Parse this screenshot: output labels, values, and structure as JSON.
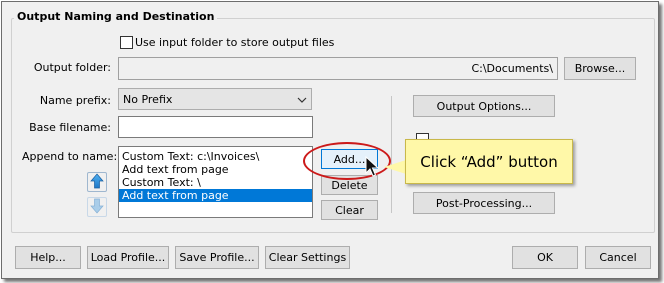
{
  "group": {
    "title": "Output Naming and Destination"
  },
  "use_input_folder": {
    "label": "Use input folder to store output files",
    "checked": false
  },
  "output_folder": {
    "label": "Output folder:",
    "value": "C:\\Documents\\",
    "browse": "Browse..."
  },
  "name_prefix": {
    "label": "Name prefix:",
    "value": "No Prefix"
  },
  "base_filename": {
    "label": "Base filename:",
    "value": ""
  },
  "append": {
    "label": "Append to name:",
    "items": [
      "Custom Text: c:\\Invoices\\",
      "Add text from page",
      "Custom Text: \\",
      "Add text from page"
    ],
    "selected_index": 3,
    "add": "Add...",
    "delete": "Delete",
    "clear": "Clear"
  },
  "right_buttons": {
    "output_options": "Output Options...",
    "post_processing": "Post-Processing..."
  },
  "callout": {
    "text": "Click “Add” button"
  },
  "footer": {
    "help": "Help...",
    "load_profile": "Load Profile...",
    "save_profile": "Save Profile...",
    "clear_settings": "Clear Settings",
    "ok": "OK",
    "cancel": "Cancel"
  },
  "colors": {
    "selection": "#0078d7",
    "annotation_oval": "#cc1a1a",
    "callout_fill": "#fff8a8"
  },
  "icons": [
    "move-up-arrow-icon",
    "move-down-arrow-icon",
    "chevron-down-icon",
    "mouse-cursor-icon"
  ]
}
